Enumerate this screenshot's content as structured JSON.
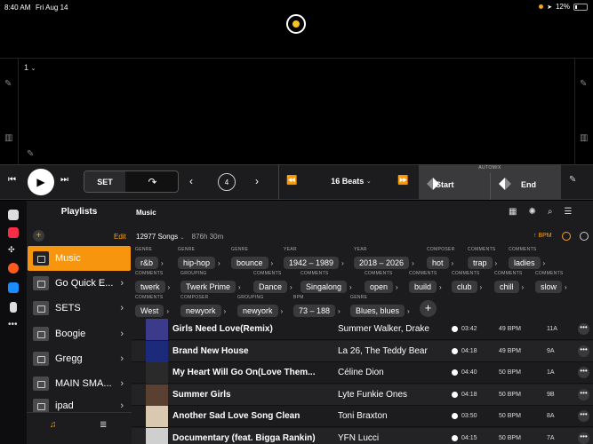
{
  "status": {
    "time": "8:40 AM",
    "date": "Fri Aug 14",
    "battery": "12%"
  },
  "deck": {
    "track_number": "1"
  },
  "transport": {
    "set_label": "SET",
    "loop_beats": "4",
    "beats_label": "16 Beats",
    "automix_label": "AUTOMIX",
    "start_label": "Start",
    "end_label": "End"
  },
  "sidebar": {
    "title": "Playlists",
    "edit_label": "Edit",
    "add_label": "+",
    "items": [
      {
        "label": "Music",
        "active": true
      },
      {
        "label": "Go Quick E..."
      },
      {
        "label": "SETS"
      },
      {
        "label": "Boogie"
      },
      {
        "label": "Gregg"
      },
      {
        "label": "MAIN SMA..."
      },
      {
        "label": "ipad"
      }
    ]
  },
  "main": {
    "title": "Music",
    "song_count": "12977 Songs",
    "duration": "876h 30m",
    "sort_label": "BPM",
    "filters_row1": [
      {
        "label": "GENRE",
        "value": "r&b"
      },
      {
        "label": "GENRE",
        "value": "hip-hop"
      },
      {
        "label": "GENRE",
        "value": "bounce"
      },
      {
        "label": "YEAR",
        "value": "1942 – 1989"
      },
      {
        "label": "YEAR",
        "value": "2018 – 2026"
      },
      {
        "label": "COMPOSER",
        "value": "hot"
      },
      {
        "label": "COMMENTS",
        "value": "trap"
      },
      {
        "label": "COMMENTS",
        "value": "ladies"
      }
    ],
    "filters_row2": [
      {
        "label": "COMMENTS",
        "value": "twerk"
      },
      {
        "label": "GROUPING",
        "value": "Twerk Prime"
      },
      {
        "label": "COMMENTS",
        "value": "Dance"
      },
      {
        "label": "COMMENTS",
        "value": "Singalong"
      },
      {
        "label": "COMMENTS",
        "value": "open"
      },
      {
        "label": "COMMENTS",
        "value": "build"
      },
      {
        "label": "COMMENTS",
        "value": "club"
      },
      {
        "label": "COMMENTS",
        "value": "chill"
      },
      {
        "label": "COMMENTS",
        "value": "slow"
      }
    ],
    "filters_row3": [
      {
        "label": "COMMENTS",
        "value": "West"
      },
      {
        "label": "COMPOSER",
        "value": "newyork"
      },
      {
        "label": "GROUPING",
        "value": "newyork"
      },
      {
        "label": "BPM",
        "value": "73 – 188"
      },
      {
        "label": "GENRE",
        "value": "Blues, blues"
      }
    ],
    "tracks": [
      {
        "title": "Girls Need Love(Remix)",
        "artist": "Summer Walker, Drake",
        "time": "03:42",
        "bpm": "49 BPM",
        "key": "11A",
        "art": "#3c3a8a"
      },
      {
        "title": "Brand New House",
        "artist": "La 26, The Teddy Bear",
        "time": "04:18",
        "bpm": "49 BPM",
        "key": "9A",
        "art": "#1b2a7a"
      },
      {
        "title": "My Heart Will Go On(Love Them...",
        "artist": "Céline Dion",
        "time": "04:40",
        "bpm": "50 BPM",
        "key": "1A",
        "art": "#2a2a2a"
      },
      {
        "title": "Summer Girls",
        "artist": "Lyte Funkie Ones",
        "time": "04:18",
        "bpm": "50 BPM",
        "key": "9B",
        "art": "#5a4030"
      },
      {
        "title": "Another Sad Love Song Clean",
        "artist": "Toni Braxton",
        "time": "03:50",
        "bpm": "50 BPM",
        "key": "8A",
        "art": "#d9c9b0"
      },
      {
        "title": "Documentary (feat. Bigga Rankin)",
        "artist": "YFN Lucci",
        "time": "04:15",
        "bpm": "50 BPM",
        "key": "7A",
        "art": "#cfcfcf"
      }
    ]
  },
  "colors": {
    "accent": "#f7950f",
    "panel": "#1c1c1e",
    "pill": "#3a3a3c"
  }
}
